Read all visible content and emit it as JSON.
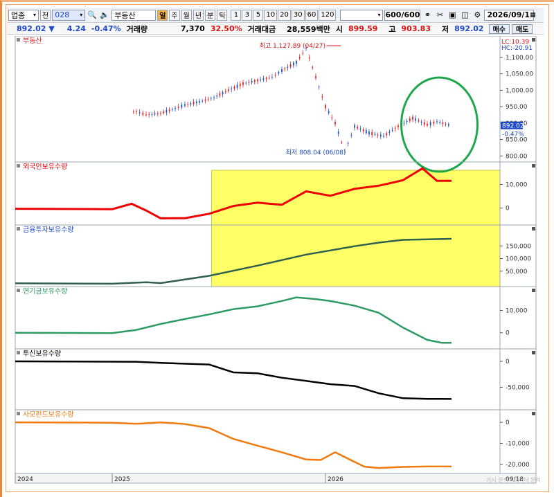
{
  "toolbar": {
    "market": "업종",
    "jeon": "전",
    "code": "028",
    "name": "부동산",
    "period_day": "일",
    "period_week": "주",
    "period_month": "월",
    "period_year": "년",
    "period_min": "분",
    "period_tick": "틱",
    "intervals": [
      "1",
      "3",
      "5",
      "10",
      "20",
      "30",
      "60",
      "120"
    ],
    "count": "600/600",
    "date": "2026/09/1"
  },
  "quote": {
    "price": "892.02",
    "arrow": "▼",
    "change": "4.24",
    "change_pct": "-0.47%",
    "vol_label": "거래량",
    "vol": "7,370",
    "vol_pct": "32.50%",
    "amt_label": "거래대금",
    "amt": "28,559백만",
    "open_label": "시",
    "open": "899.59",
    "high_label": "고",
    "high": "903.83",
    "low_label": "저",
    "low": "892.02",
    "buy": "매수",
    "sell": "매도"
  },
  "panels": {
    "p1": "부동산",
    "p2": "외국인보유수량",
    "p3": "금융투자보유수량",
    "p4": "연기금보유수량",
    "p5": "투신보유수량",
    "p6": "사모펀드보유수량"
  },
  "annotations": {
    "lc": "LC:10.39",
    "hc": "HC:-20.91",
    "max_label": "최고 1,127.89 (04/27)",
    "min_label": "최저 808.04 (06/08)",
    "last_price": "892.02",
    "last_pct": "-0.47%",
    "watermark": "거시 분석 / 데이터 분석"
  },
  "xaxis": {
    "years": [
      "2024",
      "2025",
      "2026"
    ],
    "last": "09/18"
  },
  "colors": {
    "up": "#e02020",
    "down": "#2250c8",
    "foreign": "#ee0000",
    "fin": "#2f5f4f",
    "pension": "#2e9a64",
    "trust": "#000000",
    "pef": "#ee7a10",
    "highlight": "#ffff66",
    "circle": "#1ca84a"
  },
  "chart_data": [
    {
      "type": "line",
      "title": "부동산",
      "style": "candlestick",
      "y_ticks": [
        800,
        850,
        900,
        950,
        1000,
        1050,
        1100
      ],
      "ylim": [
        790,
        1140
      ],
      "x": [
        0,
        3,
        5,
        8,
        10,
        12,
        15,
        18,
        20,
        22,
        25,
        27,
        30,
        33,
        35,
        38,
        41,
        44,
        47,
        50,
        53,
        55,
        58,
        60,
        62,
        64,
        66,
        68,
        70,
        73,
        76,
        79,
        82,
        85,
        87,
        90
      ],
      "values": [
        870,
        888,
        895,
        878,
        905,
        938,
        930,
        915,
        925,
        930,
        935,
        925,
        930,
        945,
        955,
        965,
        978,
        1000,
        1020,
        1030,
        1040,
        1060,
        1085,
        1128,
        1040,
        950,
        900,
        812,
        890,
        870,
        860,
        890,
        915,
        895,
        905,
        892
      ]
    },
    {
      "type": "line",
      "title": "외국인보유수량",
      "y_ticks": [
        0,
        10000
      ],
      "ylim": [
        -6000,
        16000
      ],
      "x": [
        0,
        20,
        24,
        27,
        30,
        35,
        40,
        45,
        50,
        55,
        60,
        65,
        70,
        75,
        80,
        84,
        87,
        90
      ],
      "values": [
        -300,
        -300,
        2000,
        -1000,
        -4500,
        -4500,
        -2500,
        1000,
        2500,
        1500,
        7000,
        5000,
        8000,
        9500,
        12000,
        17000,
        11500,
        11500
      ]
    },
    {
      "type": "line",
      "title": "금융투자보유수량",
      "y_ticks": [
        50000,
        100000,
        150000
      ],
      "ylim": [
        0,
        200000
      ],
      "x": [
        0,
        20,
        27,
        30,
        40,
        50,
        60,
        70,
        75,
        80,
        90
      ],
      "values": [
        2000,
        2000,
        8000,
        3000,
        30000,
        70000,
        115000,
        150000,
        165000,
        175000,
        178000
      ]
    },
    {
      "type": "line",
      "title": "연기금보유수량",
      "y_ticks": [
        0,
        10000
      ],
      "ylim": [
        -6000,
        17000
      ],
      "x": [
        0,
        20,
        25,
        30,
        35,
        40,
        45,
        50,
        55,
        58,
        62,
        65,
        70,
        75,
        80,
        85,
        88,
        90
      ],
      "values": [
        0,
        0,
        1500,
        4000,
        6000,
        8000,
        10500,
        12000,
        14500,
        16000,
        15000,
        14000,
        12000,
        9000,
        2500,
        -3000,
        -4500,
        -4500
      ]
    },
    {
      "type": "line",
      "title": "투신보유수량",
      "y_ticks": [
        -50000,
        0
      ],
      "ylim": [
        -88000,
        8000
      ],
      "x": [
        0,
        25,
        30,
        40,
        45,
        50,
        55,
        60,
        65,
        70,
        75,
        80,
        85,
        90
      ],
      "values": [
        0,
        0,
        -2000,
        -6000,
        -22000,
        -24000,
        -32000,
        -37000,
        -43000,
        -47000,
        -62000,
        -72000,
        -73000,
        -72500
      ]
    },
    {
      "type": "line",
      "title": "사모펀드보유수량",
      "y_ticks": [
        -20000,
        -10000,
        0
      ],
      "ylim": [
        -23000,
        2000
      ],
      "x": [
        0,
        20,
        25,
        30,
        35,
        40,
        45,
        50,
        55,
        60,
        63,
        66,
        70,
        72,
        75,
        80,
        85,
        90
      ],
      "values": [
        0,
        0,
        -500,
        0,
        -1000,
        -3000,
        -8000,
        -11000,
        -14000,
        -17500,
        -18000,
        -14500,
        -19000,
        -21000,
        -21500,
        -21000,
        -21000,
        -21000
      ]
    }
  ]
}
